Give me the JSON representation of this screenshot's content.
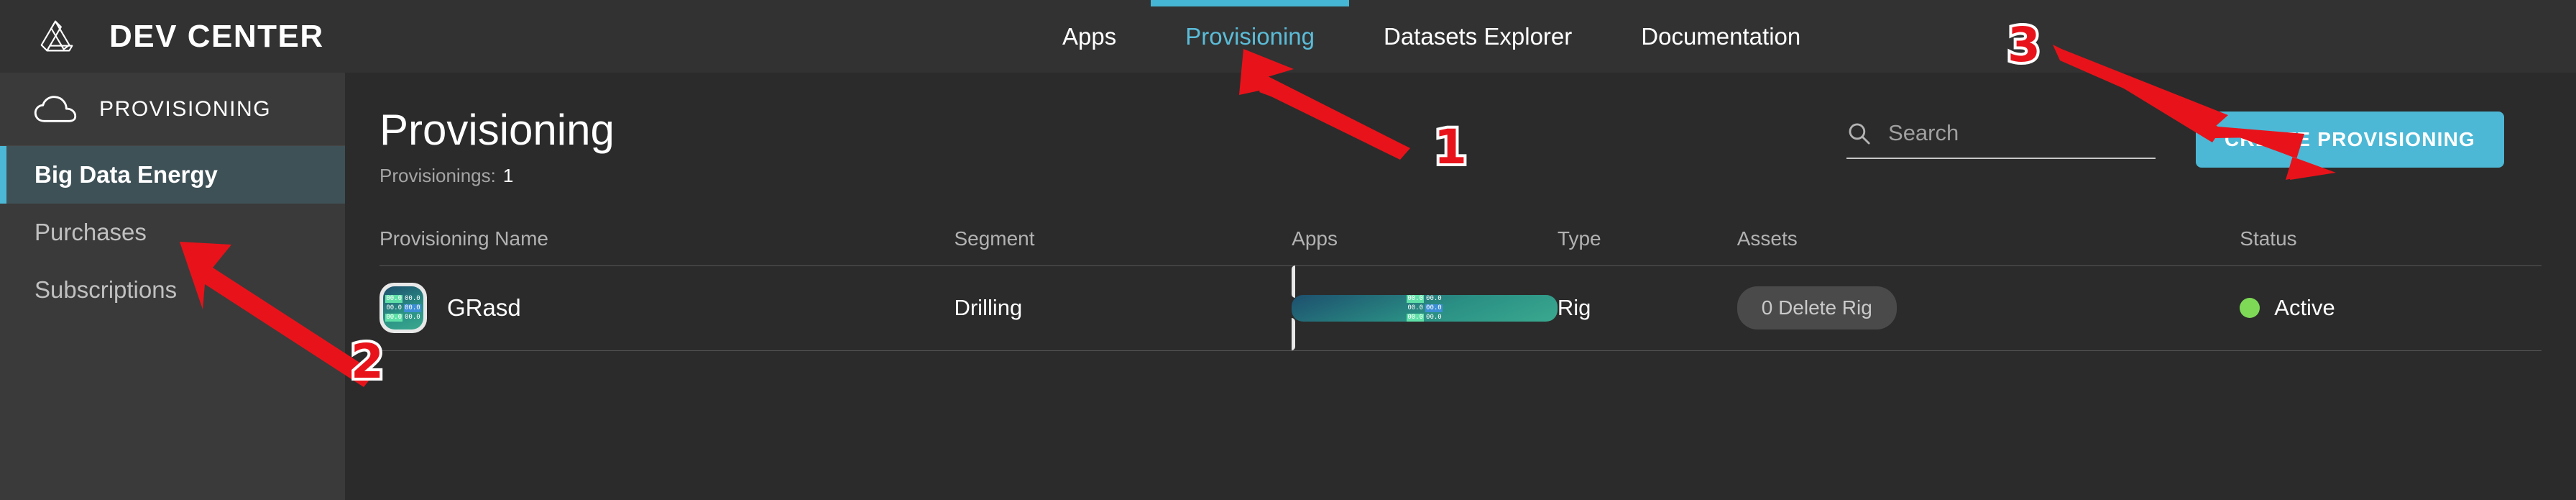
{
  "header": {
    "logo_icon": "triangle-loop-logo-icon",
    "title": "DEV CENTER",
    "nav": [
      {
        "label": "Apps",
        "active": false
      },
      {
        "label": "Provisioning",
        "active": true
      },
      {
        "label": "Datasets Explorer",
        "active": false
      },
      {
        "label": "Documentation",
        "active": false
      }
    ]
  },
  "sidebar": {
    "icon": "cloud-icon",
    "header_label": "PROVISIONING",
    "items": [
      {
        "label": "Big Data Energy",
        "active": true
      },
      {
        "label": "Purchases",
        "active": false
      },
      {
        "label": "Subscriptions",
        "active": false
      }
    ]
  },
  "main": {
    "page_title": "Provisioning",
    "subtitle_label": "Provisionings:",
    "subtitle_count": "1",
    "search": {
      "icon": "search-icon",
      "placeholder": "Search",
      "value": ""
    },
    "create_button": "CREATE PROVISIONING",
    "table": {
      "columns": [
        "Provisioning Name",
        "Segment",
        "Apps",
        "Type",
        "Assets",
        "Status"
      ],
      "rows": [
        {
          "name": "GRasd",
          "name_icon": "app-tile-icon",
          "segment": "Drilling",
          "apps_icon": "app-tile-icon",
          "type": "Rig",
          "assets": "0 Delete Rig",
          "status": "Active",
          "status_color": "#7ed957"
        }
      ]
    }
  },
  "annotations": {
    "markers": [
      {
        "label": "1",
        "points_to": "nav-item-provisioning"
      },
      {
        "label": "2",
        "points_to": "sidebar-item-purchases"
      },
      {
        "label": "3",
        "points_to": "create-provisioning-button"
      }
    ]
  },
  "colors": {
    "accent": "#4cb8d6",
    "topbar_bg": "#323232",
    "sidebar_bg": "#3a3a3a",
    "content_bg": "#2b2b2b",
    "status_active": "#7ed957",
    "annotation_red": "#e8131a"
  }
}
